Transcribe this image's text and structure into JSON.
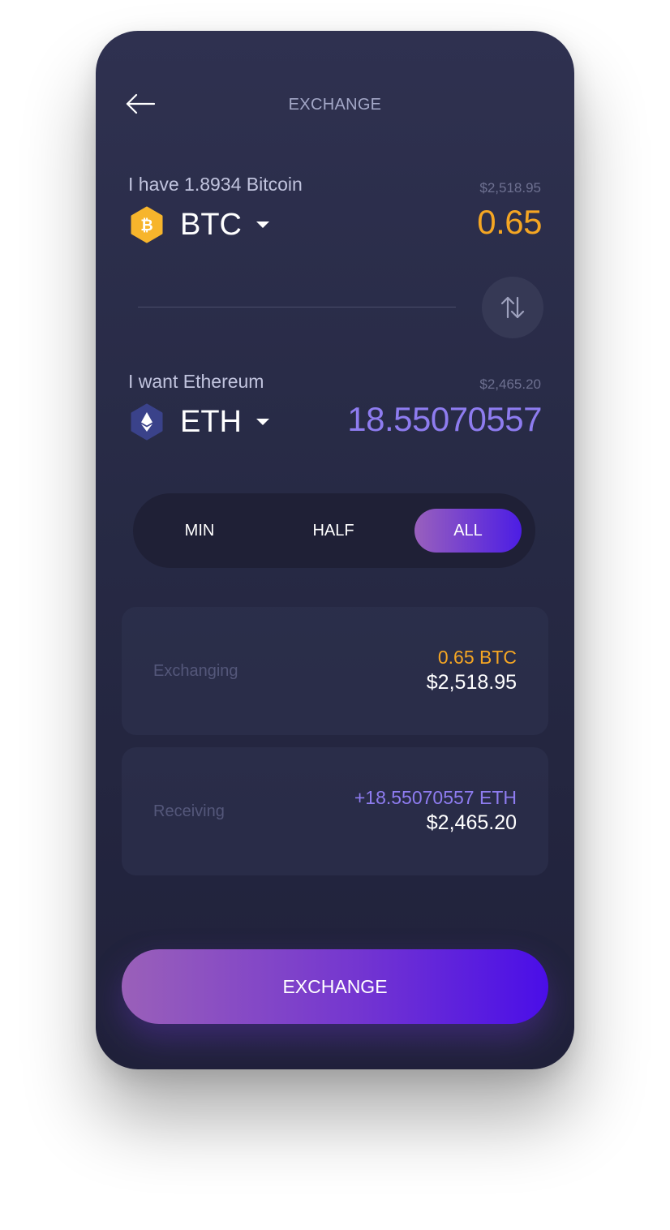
{
  "header": {
    "title": "EXCHANGE"
  },
  "from": {
    "label": "I have 1.8934 Bitcoin",
    "usd_value": "$2,518.95",
    "ticker": "BTC",
    "amount": "0.65",
    "icon": "bitcoin-icon",
    "color": "#f5a623"
  },
  "to": {
    "label": "I want Ethereum",
    "usd_value": "$2,465.20",
    "ticker": "ETH",
    "amount": "18.55070557",
    "icon": "ethereum-icon",
    "color": "#8e7cf0"
  },
  "amount_options": {
    "items": [
      "MIN",
      "HALF",
      "ALL"
    ],
    "selected": "ALL"
  },
  "summary": {
    "exchanging": {
      "label": "Exchanging",
      "crypto": "0.65 BTC",
      "fiat": "$2,518.95"
    },
    "receiving": {
      "label": "Receiving",
      "crypto": "+18.55070557 ETH",
      "fiat": "$2,465.20"
    }
  },
  "cta": {
    "label": "EXCHANGE"
  },
  "colors": {
    "accent_orange": "#f5a623",
    "accent_purple": "#8e7cf0",
    "button_gradient_start": "#9a60b9",
    "button_gradient_end": "#4a0ee8"
  }
}
